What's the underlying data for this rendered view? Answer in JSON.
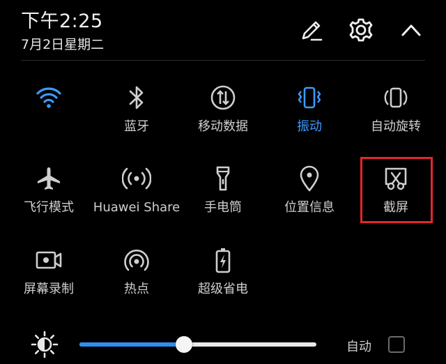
{
  "header": {
    "time": "下午2:25",
    "date": "7月2日星期二",
    "edit_icon": "pencil-edit-icon",
    "settings_icon": "gear-icon",
    "collapse_icon": "chevron-up-icon"
  },
  "colors": {
    "active": "#3d9bff",
    "inactive": "#cfcfcf",
    "highlight_border": "#e3262b",
    "slider_fill": "#2f8ff0"
  },
  "toggles": [
    {
      "id": "wifi",
      "label": "",
      "icon": "wifi-icon",
      "active": true
    },
    {
      "id": "bluetooth",
      "label": "蓝牙",
      "icon": "bluetooth-icon",
      "active": false
    },
    {
      "id": "mobile-data",
      "label": "移动数据",
      "icon": "mobile-data-icon",
      "active": false
    },
    {
      "id": "vibrate",
      "label": "振动",
      "icon": "vibrate-icon",
      "active": true
    },
    {
      "id": "auto-rotate",
      "label": "自动旋转",
      "icon": "auto-rotate-icon",
      "active": false
    },
    {
      "id": "airplane",
      "label": "飞行模式",
      "icon": "airplane-icon",
      "active": false
    },
    {
      "id": "huawei-share",
      "label": "Huawei Share",
      "icon": "huawei-share-icon",
      "active": false
    },
    {
      "id": "flashlight",
      "label": "手电筒",
      "icon": "flashlight-icon",
      "active": false
    },
    {
      "id": "location",
      "label": "位置信息",
      "icon": "location-pin-icon",
      "active": false
    },
    {
      "id": "screenshot",
      "label": "截屏",
      "icon": "screenshot-scissors-icon",
      "active": false,
      "highlighted": true
    },
    {
      "id": "screen-record",
      "label": "屏幕录制",
      "icon": "screen-record-icon",
      "active": false
    },
    {
      "id": "hotspot",
      "label": "热点",
      "icon": "hotspot-icon",
      "active": false
    },
    {
      "id": "power-saver",
      "label": "超级省电",
      "icon": "battery-saver-icon",
      "active": false
    }
  ],
  "brightness": {
    "icon": "brightness-icon",
    "level": 0.44,
    "auto_label": "自动",
    "auto_checked": false
  }
}
